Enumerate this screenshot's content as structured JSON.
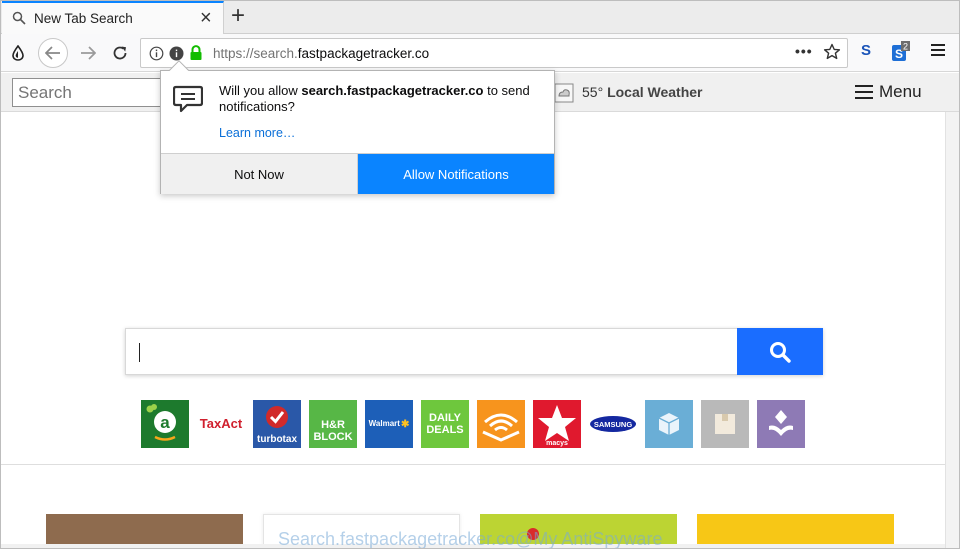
{
  "browser": {
    "tab": {
      "title": "New Tab Search",
      "close": "×"
    },
    "new_tab": "+",
    "url": {
      "prefix": "https://search.",
      "domain": "fastpackagetracker.co"
    },
    "url_more": "•••",
    "extension_badge": "2",
    "extension_s": "S"
  },
  "page_toolbar": {
    "search_placeholder": "Search",
    "weather": {
      "temp": "55°",
      "label": "Local Weather"
    },
    "menu_label": "Menu"
  },
  "popup": {
    "message_prefix": "Will you allow ",
    "message_domain": "search.fastpackagetracker.co",
    "message_suffix": " to send notifications?",
    "learn_more": "Learn more…",
    "not_now": "Not Now",
    "allow": "Allow Notifications"
  },
  "main": {
    "search_value": "",
    "tiles": [
      {
        "name": "amazon-tile",
        "label": "a",
        "color": "#1d7a2d"
      },
      {
        "name": "taxact-tile",
        "label": "TaxAct",
        "color": "#ffffff"
      },
      {
        "name": "turbotax-tile",
        "label": "turbotax",
        "color": "#2a58a8"
      },
      {
        "name": "hrblock-tile",
        "label": "H&R BLOCK",
        "color": "#57b746"
      },
      {
        "name": "walmart-tile",
        "label": "Walmart",
        "color": "#1d5fb8"
      },
      {
        "name": "daily-deals-tile",
        "label": "DAILY DEALS",
        "color": "#6ec73d"
      },
      {
        "name": "audible-tile",
        "label": "",
        "color": "#f7941d"
      },
      {
        "name": "macys-tile",
        "label": "macys",
        "color": "#e0192e"
      },
      {
        "name": "samsung-tile",
        "label": "SAMSUNG",
        "color": "#ffffff"
      },
      {
        "name": "package-tile-1",
        "label": "",
        "color": "#6aaed6"
      },
      {
        "name": "package-tile-2",
        "label": "",
        "color": "#b9b9b9"
      },
      {
        "name": "package-tile-3",
        "label": "",
        "color": "#8e7ab5"
      }
    ]
  },
  "watermark": "Search.fastpackagetracker.co@My AntiSpyware"
}
